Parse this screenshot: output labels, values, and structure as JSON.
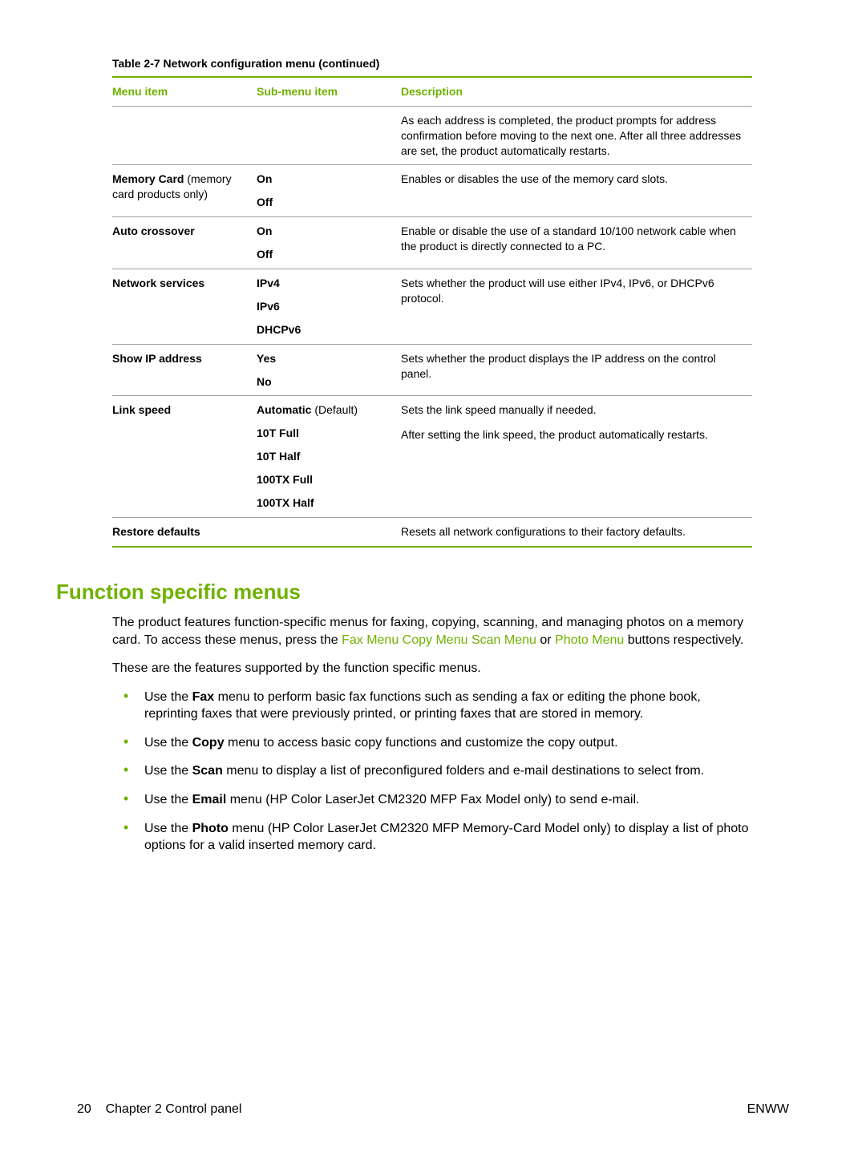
{
  "table": {
    "caption_prefix": "Table 2-7",
    "caption_suffix": "  Network configuration menu (continued)",
    "headers": {
      "menu": "Menu item",
      "sub": "Sub-menu item",
      "desc": "Description"
    },
    "rows": {
      "intro": {
        "desc": "As each address is completed, the product prompts for address confirmation before moving to the next one. After all three addresses are set, the product automatically restarts."
      },
      "memory": {
        "menu_bold": "Memory Card",
        "menu_rest": " (memory card products only)",
        "sub": {
          "on": "On",
          "off": "Off"
        },
        "desc": "Enables or disables the use of the memory card slots."
      },
      "auto": {
        "menu": "Auto crossover",
        "sub": {
          "on": "On",
          "off": "Off"
        },
        "desc": "Enable or disable the use of a standard 10/100 network cable when the product is directly connected to a PC."
      },
      "net": {
        "menu": "Network services",
        "sub": {
          "a": "IPv4",
          "b": "IPv6",
          "c": "DHCPv6"
        },
        "desc": "Sets whether the product will use either IPv4, IPv6, or DHCPv6 protocol."
      },
      "showip": {
        "menu": "Show IP address",
        "sub": {
          "yes": "Yes",
          "no": "No"
        },
        "desc": "Sets whether the product displays the IP address on the control panel."
      },
      "link": {
        "menu": "Link speed",
        "sub": {
          "auto_b": "Automatic",
          "auto_n": " (Default)",
          "a": "10T Full",
          "b": "10T Half",
          "c": "100TX Full",
          "d": "100TX Half"
        },
        "desc1": "Sets the link speed manually if needed.",
        "desc2": "After setting the link speed, the product automatically restarts."
      },
      "restore": {
        "menu": "Restore defaults",
        "desc": "Resets all network configurations to their factory defaults."
      }
    }
  },
  "heading": "Function specific menus",
  "p1a": "The product features function-specific menus for faxing, copying, scanning, and managing photos on a memory card. To access these menus, press the ",
  "p1_hl": {
    "a": "Fax Menu",
    "b": "Copy Menu",
    "c": "Scan Menu",
    "d": "Photo Menu"
  },
  "p1_or": " or ",
  "p1_end": " buttons respectively.",
  "p2": "These are the features supported by the function specific menus.",
  "b1a": "Use the ",
  "b1b": "Fax",
  "b1c": " menu to perform basic fax functions such as sending a fax or editing the phone book, reprinting faxes that were previously printed, or printing faxes that are stored in memory.",
  "b2a": "Use the ",
  "b2b": "Copy",
  "b2c": " menu to access basic copy functions and customize the copy output.",
  "b3a": "Use the ",
  "b3b": "Scan",
  "b3c": " menu to display a list of preconfigured folders and e-mail destinations to select from.",
  "b4a": "Use the ",
  "b4b": "Email",
  "b4c": " menu (HP Color LaserJet CM2320 MFP Fax Model only) to send e-mail.",
  "b5a": "Use the ",
  "b5b": "Photo",
  "b5c": " menu (HP Color LaserJet CM2320 MFP Memory-Card Model only) to display a list of photo options for a valid inserted memory card.",
  "footer": {
    "pagenum": "20",
    "chapter": "Chapter 2   Control panel",
    "right": "ENWW"
  }
}
